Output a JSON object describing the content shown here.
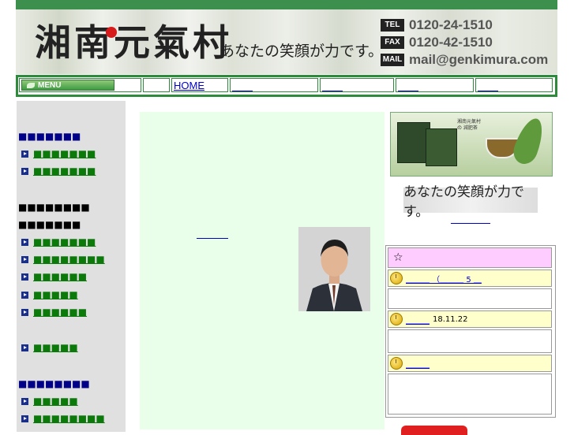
{
  "header": {
    "logo_text": "湘南元氣村",
    "tagline": "あなたの笑顔が力です。",
    "contact": [
      {
        "tag": "TEL",
        "value": "0120-24-1510"
      },
      {
        "tag": "FAX",
        "value": "0120-42-1510"
      },
      {
        "tag": "MAIL",
        "value": "mail@genkimura.com"
      }
    ]
  },
  "nav": {
    "menu_label": "MENU",
    "home_label": "HOME",
    "links": [
      "＿＿",
      "＿＿",
      "＿＿",
      "＿＿"
    ]
  },
  "sidebar": {
    "heading1": "■■■■■■■",
    "group1": [
      "■■■■■■■",
      "■■■■■■■"
    ],
    "heading2": "■■■■■■■■",
    "heading2b": "■■■■■■■",
    "group2": [
      "■■■■■■■",
      "■■■■■■■■",
      "■■■■■■",
      "■■■■■",
      "■■■■■■"
    ],
    "single": "■■■■■",
    "heading3": "■■■■■■■■",
    "group3": [
      "■■■■■",
      "■■■■■■■■"
    ]
  },
  "right": {
    "slogan": "あなたの笑顔が力です。",
    "product_caption": "湘南元氣村の 減肥茶",
    "news": {
      "star": "☆",
      "items": [
        {
          "link": "＿＿＿ （＿＿＿ 5 ＿",
          "text": ""
        },
        {
          "link": "＿＿＿",
          "text": "18.11.22"
        },
        {
          "link": "＿＿＿",
          "text": ""
        }
      ]
    }
  },
  "colors": {
    "brand_green": "#2e8b3c",
    "top_bar": "#3d8f4e",
    "center_bg": "#eaffea",
    "news_star_bg": "#ffccff",
    "news_item_bg": "#ffffcc"
  }
}
